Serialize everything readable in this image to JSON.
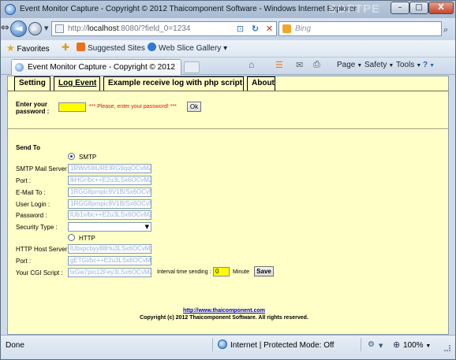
{
  "window": {
    "title": "Event Monitor Capture - Copyright © 2012 Thaicomponent Software - Windows Internet Explorer",
    "watermark": "SOFTPE",
    "min_label": "–",
    "max_label": "□",
    "close_label": "X"
  },
  "addressbar": {
    "url_prefix": "http://",
    "url_host": "localhost",
    "url_rest": ":8080/?field_0=1234",
    "search_placeholder": "Bing",
    "back_label": "◄",
    "forward_label": "►"
  },
  "favorites": {
    "favorites_label": "Favorites",
    "links": [
      {
        "label": "Suggested Sites ▾"
      },
      {
        "label": "Web Slice Gallery ▾"
      }
    ]
  },
  "tab": {
    "title": "Event Monitor Capture - Copyright © 2012 Thaic..."
  },
  "commandbar": {
    "page": "Page",
    "safety": "Safety",
    "tools": "Tools",
    "help": "?"
  },
  "page": {
    "tabs": [
      "Setting",
      "Log Event",
      "Example receive log with php script",
      "About"
    ],
    "active_tab": "Setting",
    "password_label_line1": "Enter your",
    "password_label_line2": "password :",
    "password_value": "",
    "password_message": "*** Please, enter your password! ***",
    "ok_button": "Ok",
    "send_to_label": "Send To",
    "smtp_label": "SMTP",
    "smtp_selected": true,
    "fields": [
      {
        "label": "SMTP Mail Server :",
        "value": "1RWv59iUREIRG9qqOCvMZ8"
      },
      {
        "label": "Port :",
        "value": "lkHGr/bc++E2u3LSx6OCvMZ8"
      },
      {
        "label": "E-Mail To :",
        "value": "1RGG8pmpic9V1B/Sx6OCvMZ8"
      },
      {
        "label": "User Login :",
        "value": "1RGG8pmpic9V1B/Sx6OCvMZ8"
      },
      {
        "label": "Password :",
        "value": "lUb1v/bc++E2u3LSx6OCvMZ8"
      }
    ],
    "security_type_label": "Security Type :",
    "security_type_value": "",
    "http_label": "HTTP",
    "http_selected": false,
    "http_fields": [
      {
        "label": "HTTP Host Server :",
        "value": "lUbxpcbyy88Hu3LSx6OCvMZ8"
      },
      {
        "label": "Port :",
        "value": "gETGi/bc++E2u3LSx6OCvMZ8"
      },
      {
        "label": "Your CGI Script :",
        "value": "lxGw7pio12Fey3LSx6OCvMZ8"
      }
    ],
    "interval_label": "Interval time sending :",
    "interval_value": "0",
    "minute_label": "Minute",
    "save_button": "Save",
    "footer_link": "http://www.thaicomponent.com",
    "footer_copyright": "Copyright (c) 2012 Thaicomponent Software. All rights reserved."
  },
  "statusbar": {
    "status": "Done",
    "zone": "Internet | Protected Mode: Off",
    "zoom": "100%"
  },
  "colors": {
    "page_background": "#ffffc8",
    "highlight_input": "#ffff00",
    "error_text": "#e01010",
    "link": "#0000cc"
  }
}
